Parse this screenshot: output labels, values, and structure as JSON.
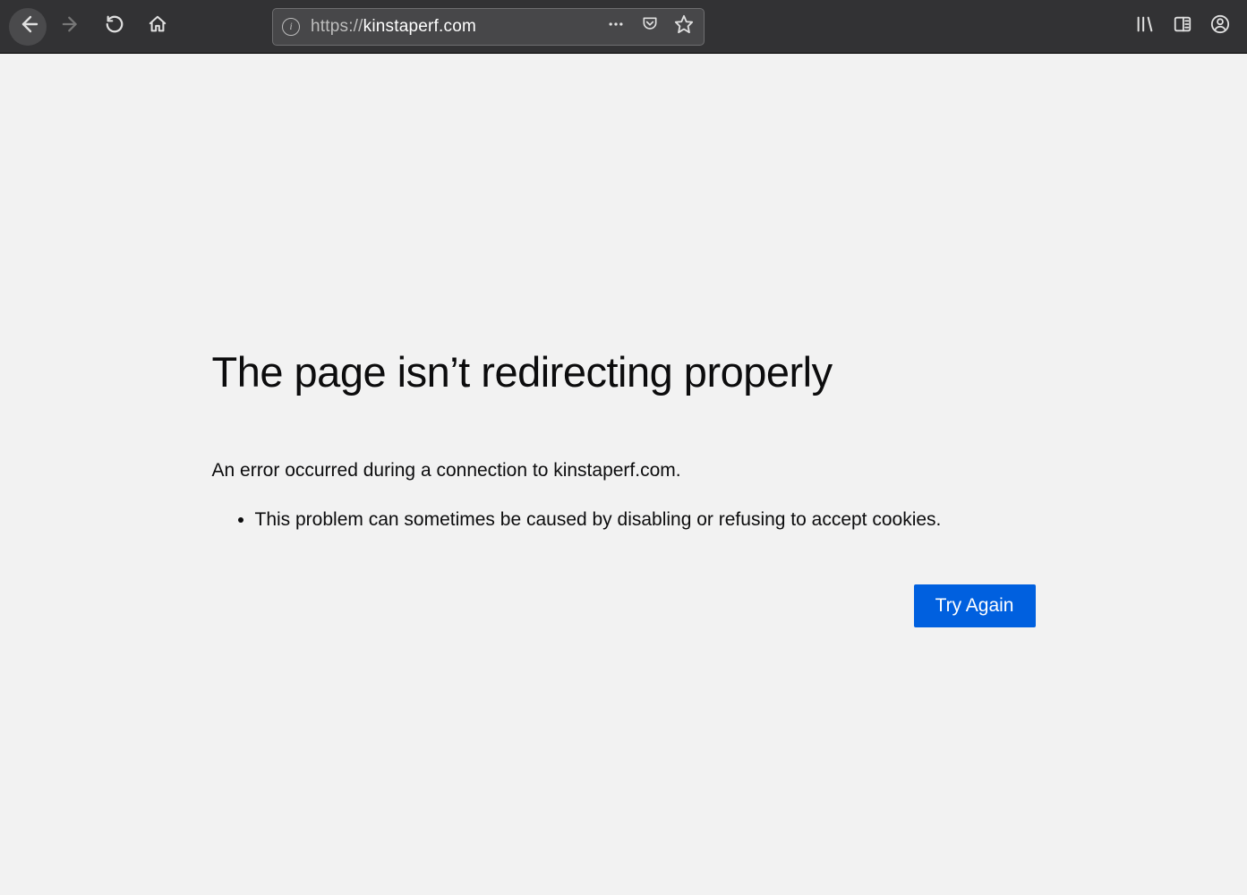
{
  "toolbar": {
    "url_prefix": "https://",
    "url_domain": "kinstaperf.com",
    "url_rest": ""
  },
  "error": {
    "title": "The page isn’t redirecting properly",
    "description": "An error occurred during a connection to kinstaperf.com.",
    "bullets": [
      "This problem can sometimes be caused by disabling or refusing to accept cookies."
    ],
    "try_again_label": "Try Again"
  }
}
